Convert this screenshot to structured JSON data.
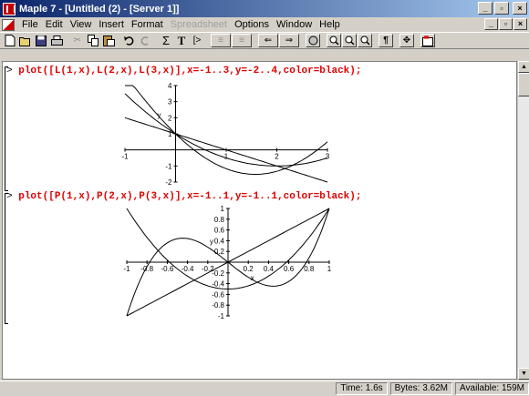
{
  "window": {
    "title": "Maple 7 - [Untitled (2) - [Server 1]]"
  },
  "menu": [
    "File",
    "Edit",
    "View",
    "Insert",
    "Format",
    "Spreadsheet",
    "Options",
    "Window",
    "Help"
  ],
  "toolbar": {
    "sigma_label": "Σ",
    "text_label": "T",
    "prompt_label": "[>",
    "para_label": "¶"
  },
  "worksheet": {
    "prompt_symbol": ">",
    "commands": [
      "plot([L(1,x),L(2,x),L(3,x)],x=-1..3,y=-2..4,color=black);",
      "plot([P(1,x),P(2,x),P(3,x)],x=-1..1,y=-1..1,color=black);"
    ]
  },
  "chart_data": [
    {
      "type": "line",
      "title": "",
      "xlabel": "",
      "ylabel": "y",
      "xlim": [
        -1,
        3
      ],
      "ylim": [
        -2,
        4
      ],
      "xticks": [
        "-1",
        "1",
        "2",
        "3"
      ],
      "yticks": [
        "4",
        "3",
        "2",
        "1",
        "-1",
        "-2"
      ],
      "grid": false,
      "series": [
        {
          "x": [
            -1,
            0,
            1,
            2,
            3
          ],
          "y": [
            2,
            1,
            0,
            -1,
            -2
          ]
        },
        {
          "x": [
            -1,
            0,
            1,
            2,
            3
          ],
          "y": [
            3.5,
            1,
            -0.5,
            -1,
            -0.5
          ]
        },
        {
          "x": [
            -1,
            0,
            1,
            2,
            3
          ],
          "y": [
            4.67,
            1,
            -1.17,
            -1.33,
            0.5
          ]
        }
      ]
    },
    {
      "type": "line",
      "title": "",
      "xlabel": "x",
      "ylabel": "y",
      "xlim": [
        -1,
        1
      ],
      "ylim": [
        -1,
        1
      ],
      "xticks": [
        "-1",
        "-0.8",
        "-0.6",
        "-0.4",
        "-0.2",
        "0",
        "0.2",
        "0.4",
        "0.6",
        "0.8",
        "1"
      ],
      "yticks": [
        "1",
        "0.8",
        "0.6",
        "0.4",
        "0.2",
        "-0.2",
        "-0.4",
        "-0.6",
        "-0.8",
        "-1"
      ],
      "grid": false,
      "series": [
        {
          "x": [
            -1,
            1
          ],
          "y": [
            -1,
            1
          ]
        },
        {
          "x": [
            -1,
            -0.5,
            0,
            0.5,
            1
          ],
          "y": [
            1,
            -0.125,
            -0.5,
            -0.125,
            1
          ]
        },
        {
          "x": [
            -1,
            -0.5,
            0,
            0.5,
            1
          ],
          "y": [
            -1,
            0.4375,
            0,
            -0.4375,
            1
          ]
        }
      ]
    }
  ],
  "status": {
    "time": "Time:   1.6s",
    "bytes": "Bytes: 3.62M",
    "available": "Available: 159M"
  }
}
